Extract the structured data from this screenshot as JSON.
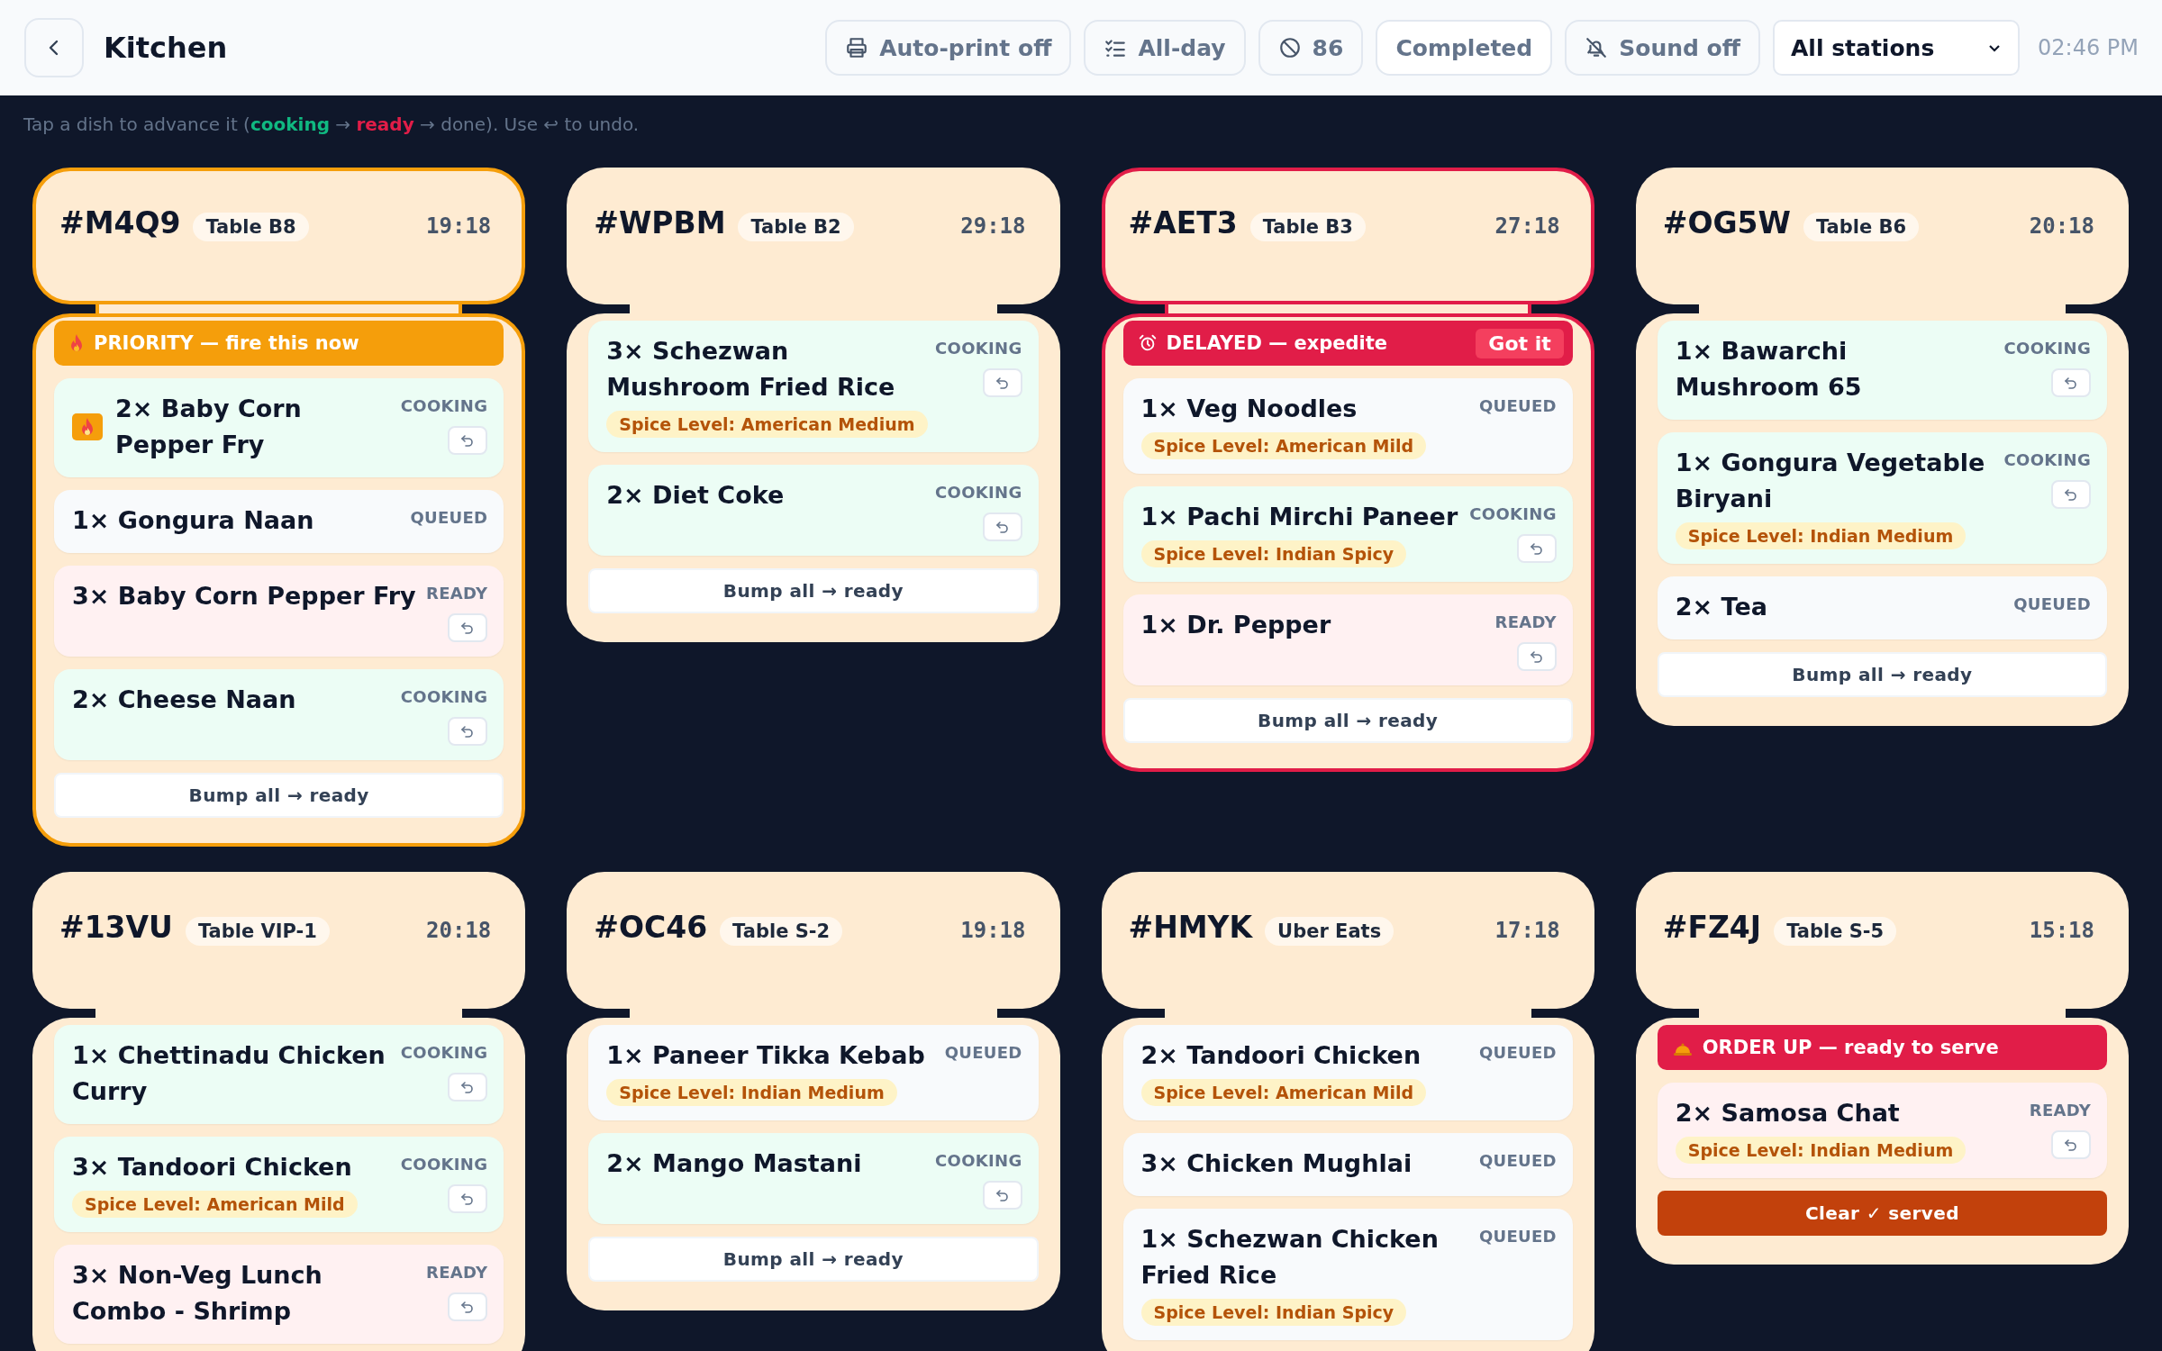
{
  "header": {
    "title": "Kitchen",
    "buttons": [
      {
        "kind": "printer",
        "label": "Auto-print off"
      },
      {
        "kind": "checklist",
        "label": "All-day"
      },
      {
        "kind": "ban",
        "label": "86"
      },
      {
        "kind": "none",
        "label": "Completed"
      },
      {
        "kind": "bell-off",
        "label": "Sound off"
      }
    ],
    "station_select": {
      "value": "All stations"
    },
    "time": "02:46 PM"
  },
  "hint": [
    {
      "text": "Tap a dish to advance it (",
      "color": "#64748b"
    },
    {
      "text": "cooking",
      "color": "#10b981"
    },
    {
      "text": " → ",
      "color": "#64748b"
    },
    {
      "text": "ready",
      "color": "#e11d48"
    },
    {
      "text": " → done). Use ↩ to undo.",
      "color": "#64748b"
    }
  ],
  "tickets": [
    {
      "id": "#M4Q9",
      "source": "Table B8",
      "timer": "19:18",
      "kind": "priority",
      "banner": {
        "kind": "priority",
        "text": "PRIORITY — fire this now"
      },
      "items": [
        {
          "name": "2× Baby Corn Pepper Fry",
          "status": "COOKING",
          "kind": "cooking",
          "flagged": true
        },
        {
          "name": "1× Gongura Naan",
          "status": "QUEUED",
          "kind": "queued",
          "flagged": false
        },
        {
          "name": "3× Baby Corn Pepper Fry",
          "status": "READY",
          "kind": "ready",
          "flagged": false
        },
        {
          "name": "2× Cheese Naan",
          "status": "COOKING",
          "kind": "cooking",
          "flagged": false
        }
      ],
      "footer": {
        "kind": "bump",
        "label": "Bump all → ready"
      }
    },
    {
      "id": "#WPBM",
      "source": "Table B2",
      "timer": "29:18",
      "kind": "normal",
      "items": [
        {
          "name": "3× Schezwan Mushroom Fried Rice",
          "status": "COOKING",
          "kind": "cooking",
          "spice": "Spice Level: American Medium",
          "flagged": false
        },
        {
          "name": "2× Diet Coke",
          "status": "COOKING",
          "kind": "cooking",
          "flagged": false
        }
      ],
      "footer": {
        "kind": "bump",
        "label": "Bump all → ready"
      }
    },
    {
      "id": "#AET3",
      "source": "Table B3",
      "timer": "27:18",
      "kind": "delayed",
      "banner": {
        "kind": "delayed",
        "text": "DELAYED — expedite",
        "action": "Got it"
      },
      "items": [
        {
          "name": "1× Veg Noodles",
          "status": "QUEUED",
          "kind": "queued",
          "spice": "Spice Level: American Mild",
          "flagged": false
        },
        {
          "name": "1× Pachi Mirchi Paneer",
          "status": "COOKING",
          "kind": "cooking",
          "spice": "Spice Level: Indian Spicy",
          "flagged": false
        },
        {
          "name": "1× Dr. Pepper",
          "status": "READY",
          "kind": "ready",
          "flagged": false
        }
      ],
      "footer": {
        "kind": "bump",
        "label": "Bump all → ready"
      }
    },
    {
      "id": "#OG5W",
      "source": "Table B6",
      "timer": "20:18",
      "kind": "normal",
      "items": [
        {
          "name": "1× Bawarchi Mushroom 65",
          "status": "COOKING",
          "kind": "cooking",
          "flagged": false
        },
        {
          "name": "1× Gongura Vegetable Biryani",
          "status": "COOKING",
          "kind": "cooking",
          "spice": "Spice Level: Indian Medium",
          "flagged": false
        },
        {
          "name": "2× Tea",
          "status": "QUEUED",
          "kind": "queued",
          "flagged": false
        }
      ],
      "footer": {
        "kind": "bump",
        "label": "Bump all → ready"
      }
    },
    {
      "id": "#13VU",
      "source": "Table VIP-1",
      "timer": "20:18",
      "kind": "normal",
      "items": [
        {
          "name": "1× Chettinadu Chicken Curry",
          "status": "COOKING",
          "kind": "cooking",
          "flagged": false
        },
        {
          "name": "3× Tandoori Chicken",
          "status": "COOKING",
          "kind": "cooking",
          "spice": "Spice Level: American Mild",
          "flagged": false
        },
        {
          "name": "3× Non-Veg Lunch Combo - Shrimp",
          "status": "READY",
          "kind": "ready",
          "flagged": false
        }
      ]
    },
    {
      "id": "#OC46",
      "source": "Table S-2",
      "timer": "19:18",
      "kind": "normal",
      "items": [
        {
          "name": "1× Paneer Tikka Kebab",
          "status": "QUEUED",
          "kind": "queued",
          "spice": "Spice Level: Indian Medium",
          "flagged": false
        },
        {
          "name": "2× Mango Mastani",
          "status": "COOKING",
          "kind": "cooking",
          "flagged": false
        }
      ],
      "footer": {
        "kind": "bump",
        "label": "Bump all → ready"
      }
    },
    {
      "id": "#HMYK",
      "source": "Uber Eats",
      "timer": "17:18",
      "kind": "normal",
      "items": [
        {
          "name": "2× Tandoori Chicken",
          "status": "QUEUED",
          "kind": "queued",
          "spice": "Spice Level: American Mild",
          "flagged": false
        },
        {
          "name": "3× Chicken Mughlai",
          "status": "QUEUED",
          "kind": "queued",
          "flagged": false
        },
        {
          "name": "1× Schezwan Chicken Fried Rice",
          "status": "QUEUED",
          "kind": "queued",
          "spice": "Spice Level: Indian Spicy",
          "flagged": false
        }
      ]
    },
    {
      "id": "#FZ4J",
      "source": "Table S-5",
      "timer": "15:18",
      "kind": "normal",
      "banner": {
        "kind": "order_up",
        "text": "ORDER UP — ready to serve"
      },
      "items": [
        {
          "name": "2× Samosa Chat",
          "status": "READY",
          "kind": "ready",
          "spice": "Spice Level: Indian Medium",
          "flagged": false
        }
      ],
      "footer": {
        "kind": "clear",
        "label": "Clear ✓ served"
      }
    }
  ]
}
